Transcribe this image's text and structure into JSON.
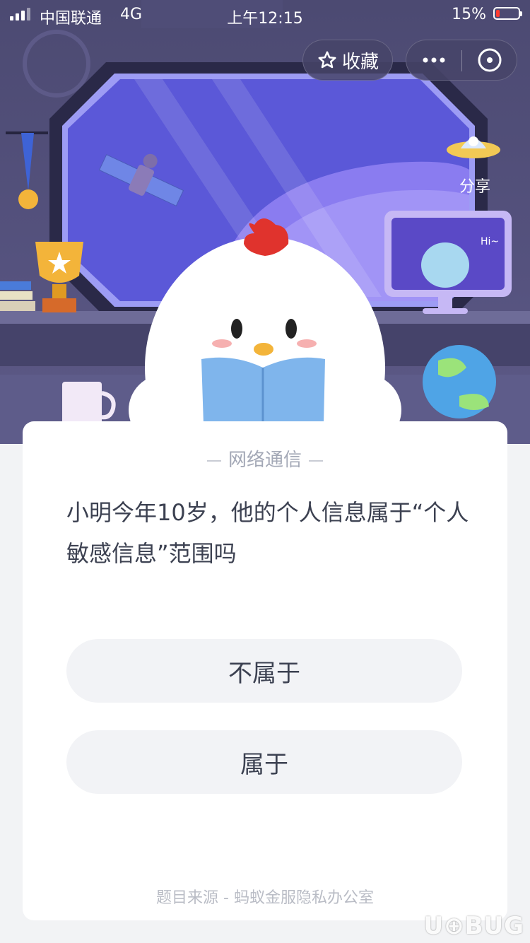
{
  "status_bar": {
    "carrier": "中国联通",
    "network": "4G",
    "time": "上午12:15",
    "battery": "15%"
  },
  "top_bar": {
    "favorite_label": "收藏"
  },
  "share": {
    "label": "分享"
  },
  "scene": {
    "monitor_text": "Hi~"
  },
  "quiz": {
    "category": "网络通信",
    "question": "小明今年10岁，他的个人信息属于“个人敏感信息”范围吗",
    "answers": [
      {
        "label": "不属于"
      },
      {
        "label": "属于"
      }
    ],
    "source": "题目来源 - 蚂蚁金服隐私办公室"
  },
  "watermark": "U⊕BUG"
}
